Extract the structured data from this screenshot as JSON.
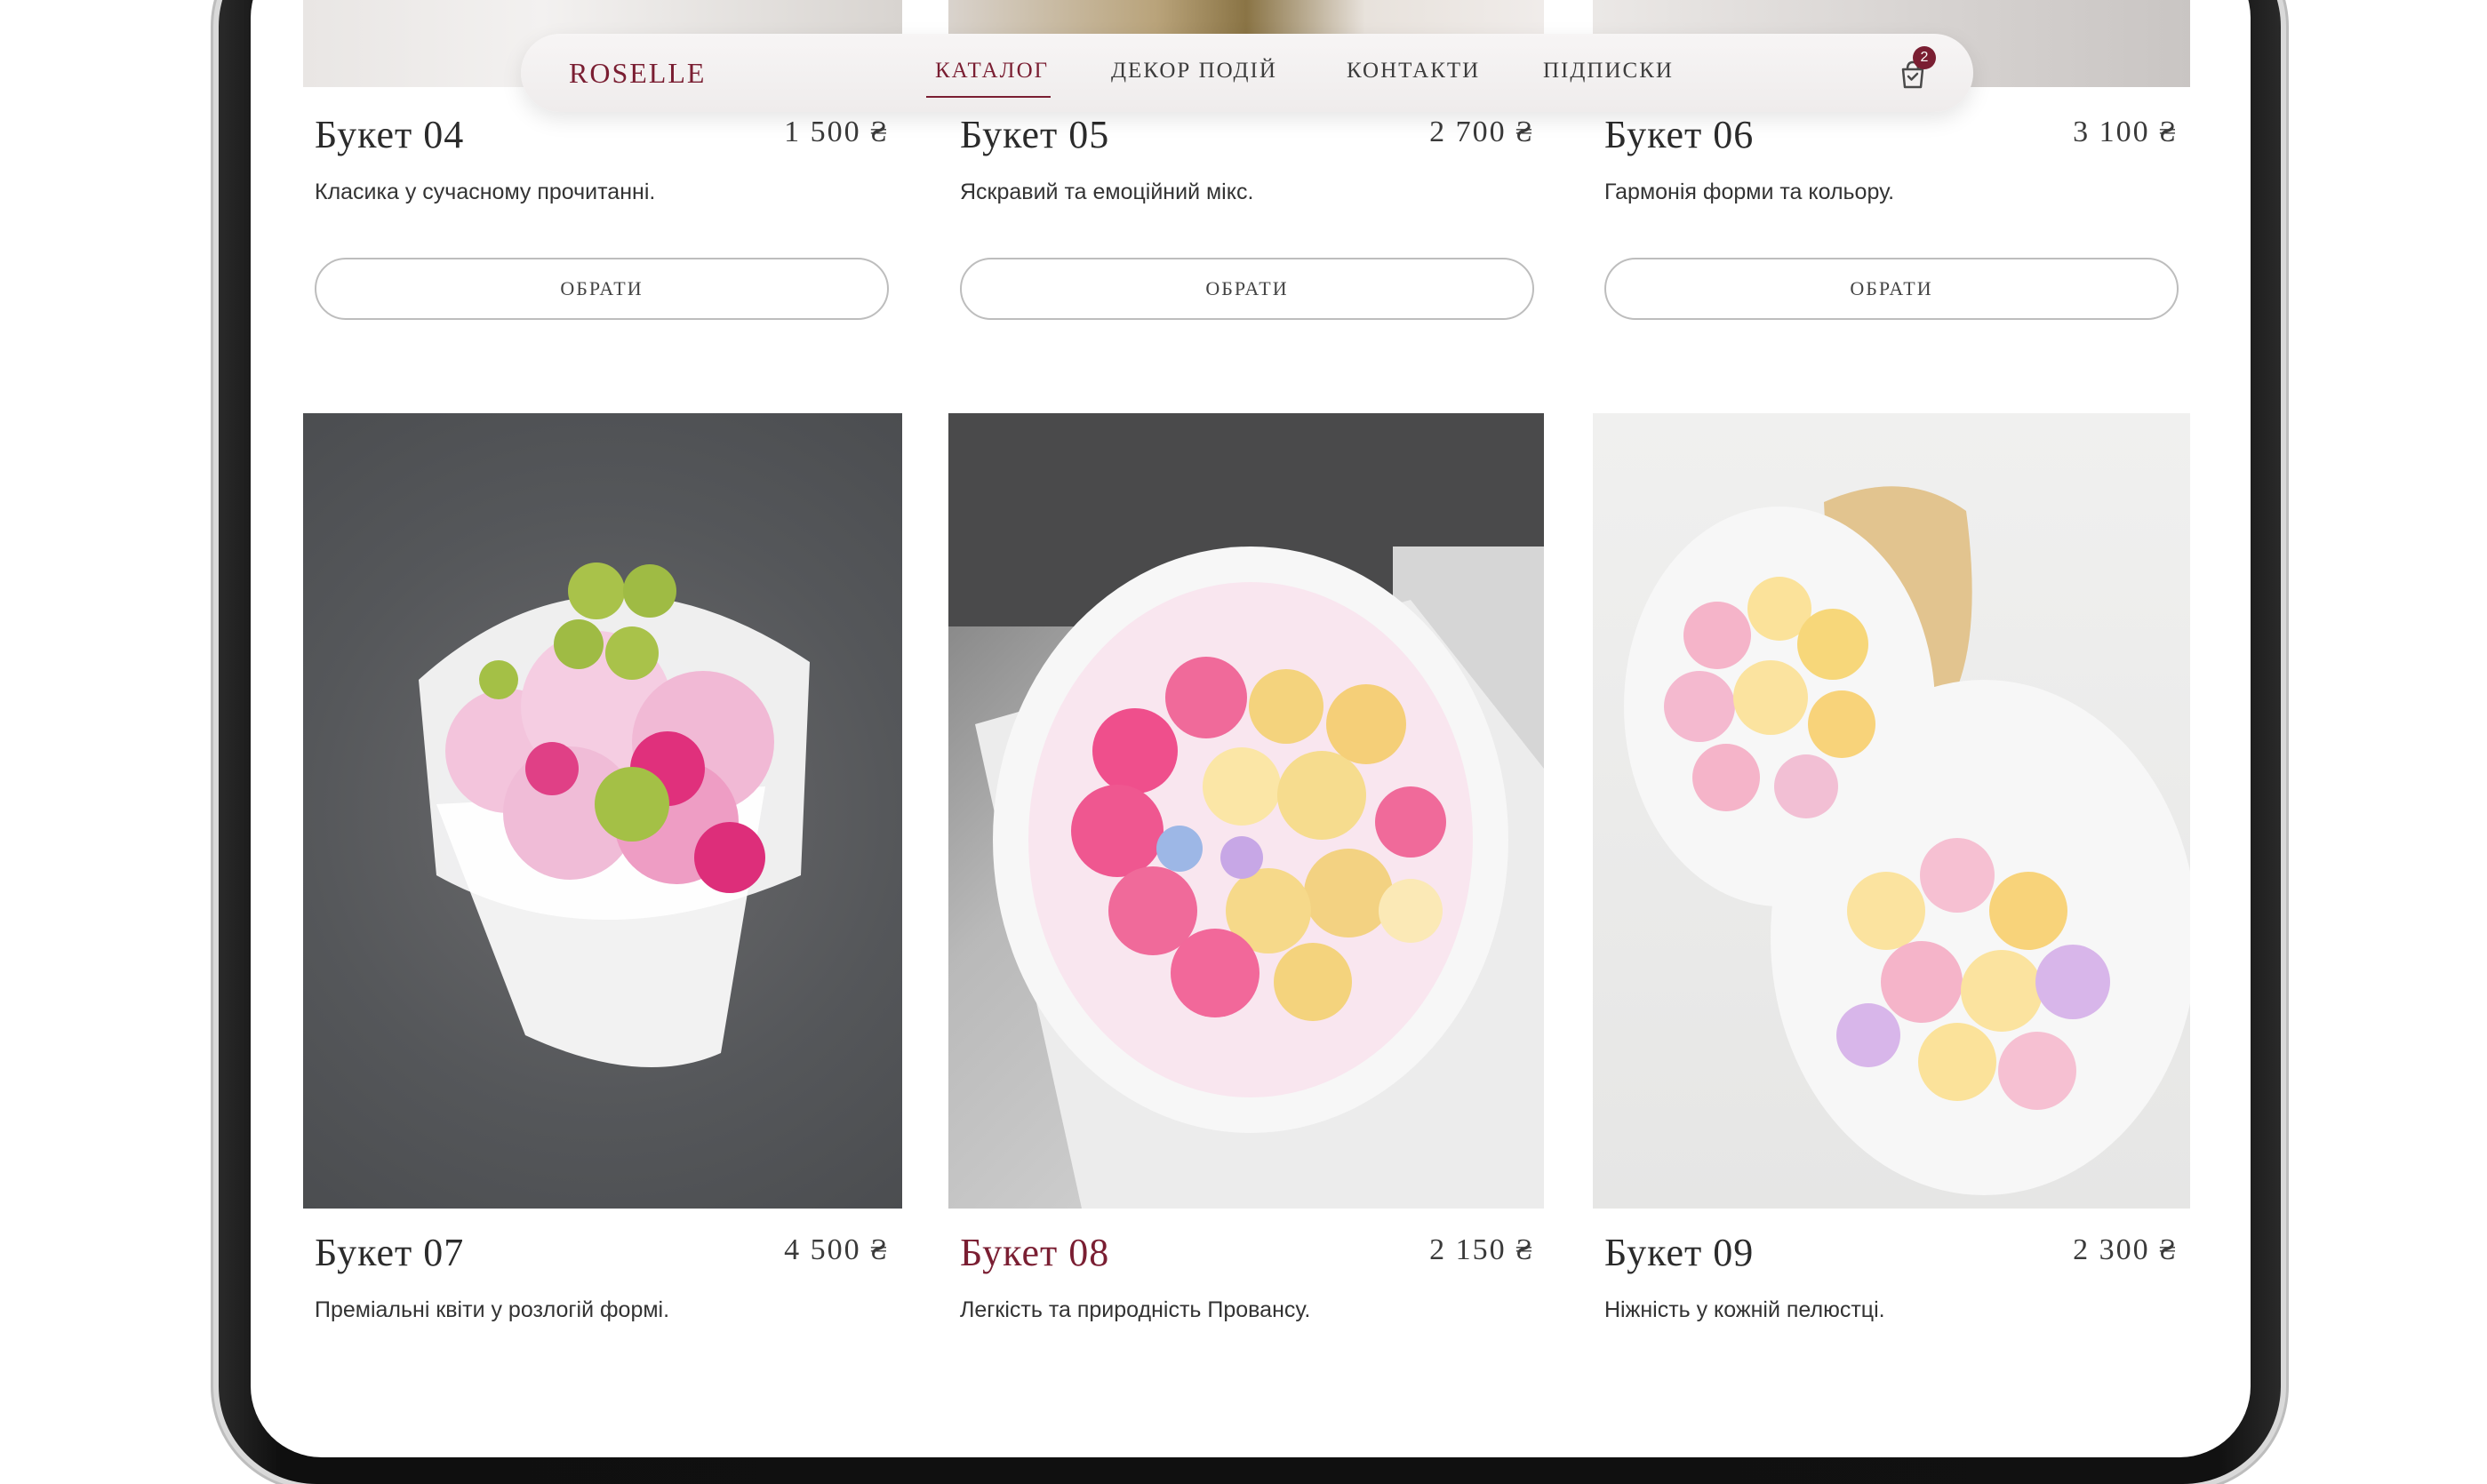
{
  "header": {
    "logo": "ROSELLE",
    "nav": [
      "КАТАЛОГ",
      "ДЕКОР ПОДІЙ",
      "КОНТАКТИ",
      "ПІДПИСКИ"
    ],
    "active_nav": "КАТАЛОГ",
    "cart_count": "2",
    "cart_icon": "shopping-bag-icon"
  },
  "colors": {
    "accent": "#7a1e32",
    "text": "#2b2b2b",
    "button_border": "#bdbdbd"
  },
  "products_row1": [
    {
      "title": "Букет 04",
      "price": "1 500 ₴",
      "desc": "Класика у сучасному прочитанні.",
      "button": "ОБРАТИ"
    },
    {
      "title": "Букет 05",
      "price": "2 700 ₴",
      "desc": "Яскравий та емоційний мікс.",
      "button": "ОБРАТИ"
    },
    {
      "title": "Букет 06",
      "price": "3 100 ₴",
      "desc": "Гармонія форми та кольору.",
      "button": "ОБРАТИ"
    }
  ],
  "products_row2": [
    {
      "title": "Букет 07",
      "price": "4 500 ₴",
      "desc": "Преміальні квіти у розлогій формі."
    },
    {
      "title": "Букет 08",
      "price": "2 150 ₴",
      "desc": "Легкість та природність Провансу."
    },
    {
      "title": "Букет 09",
      "price": "2 300 ₴",
      "desc": "Ніжність у кожній пелюстці."
    }
  ]
}
